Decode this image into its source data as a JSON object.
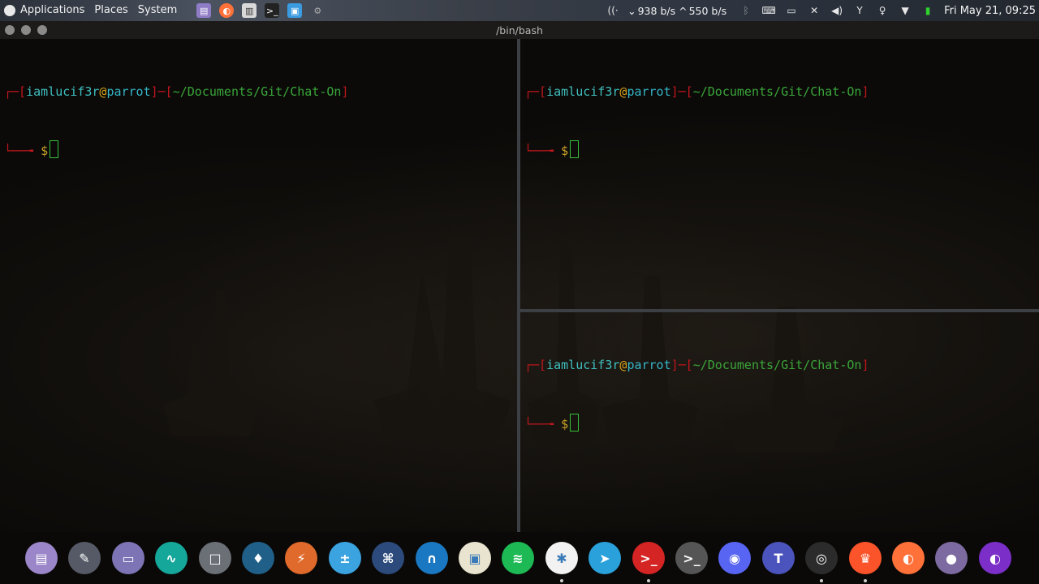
{
  "panel": {
    "menus": [
      "Applications",
      "Places",
      "System"
    ],
    "net_down": "938 b/s",
    "net_up": "550 b/s",
    "clock": "Fri May 21, 09:25"
  },
  "window": {
    "title": "/bin/bash"
  },
  "prompt": {
    "user": "iamlucif3r",
    "at": "@",
    "host": "parrot",
    "path": "~/Documents/Git/Chat-On",
    "symbol": "$"
  },
  "dock": {
    "apps": [
      {
        "name": "text-editor",
        "color": "#9a86c8",
        "glyph": "▤"
      },
      {
        "name": "screen-recorder",
        "color": "#555a66",
        "glyph": "✎"
      },
      {
        "name": "files",
        "color": "#7d74b5",
        "glyph": "▭"
      },
      {
        "name": "system-monitor",
        "color": "#16a79b",
        "glyph": "∿"
      },
      {
        "name": "virtual-box",
        "color": "#6b6f76",
        "glyph": "□"
      },
      {
        "name": "network-spy",
        "color": "#1f5f88",
        "glyph": "♦"
      },
      {
        "name": "burpsuite",
        "color": "#e06a2c",
        "glyph": "⚡"
      },
      {
        "name": "calculator",
        "color": "#3aa3e0",
        "glyph": "±"
      },
      {
        "name": "hex-editor",
        "color": "#2c4b7c",
        "glyph": "⌘"
      },
      {
        "name": "wireshark",
        "color": "#1a78c2",
        "glyph": "∩"
      },
      {
        "name": "screenshot",
        "color": "#e8e4cf",
        "glyph": "▣"
      },
      {
        "name": "spotify",
        "color": "#1db954",
        "glyph": "≋"
      },
      {
        "name": "maltego",
        "color": "#f2f2f2",
        "glyph": "✱"
      },
      {
        "name": "telegram",
        "color": "#2aa1da",
        "glyph": "➤"
      },
      {
        "name": "tilix",
        "color": "#d52424",
        "glyph": ">_"
      },
      {
        "name": "terminal",
        "color": "#555555",
        "glyph": ">_"
      },
      {
        "name": "discord",
        "color": "#5865f2",
        "glyph": "◉"
      },
      {
        "name": "teams",
        "color": "#4b53bc",
        "glyph": "T"
      },
      {
        "name": "obs-studio",
        "color": "#2b2b2b",
        "glyph": "◎"
      },
      {
        "name": "brave",
        "color": "#fb542b",
        "glyph": "♛"
      },
      {
        "name": "firefox",
        "color": "#ff7139",
        "glyph": "◐"
      },
      {
        "name": "tor-browser",
        "color": "#7d6aa0",
        "glyph": "●"
      },
      {
        "name": "firefox-nightly",
        "color": "#7b2fc8",
        "glyph": "◐"
      }
    ]
  }
}
